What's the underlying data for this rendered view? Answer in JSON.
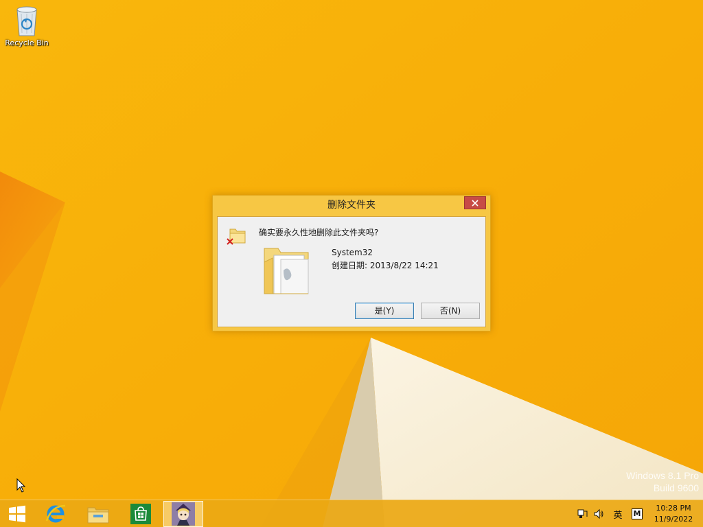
{
  "desktop": {
    "icons": [
      {
        "label": "Recycle Bin",
        "icon": "recycle-bin-icon"
      }
    ],
    "watermark": {
      "line1": "Windows 8.1 Pro",
      "line2": "Build 9600"
    }
  },
  "dialog": {
    "title": "删除文件夹",
    "question": "确实要永久性地删除此文件夹吗?",
    "item_name": "System32",
    "item_date": "创建日期: 2013/8/22 14:21",
    "yes_label": "是(Y)",
    "no_label": "否(N)",
    "icons": [
      "folder-delete-icon",
      "folder-icon",
      "close-icon"
    ]
  },
  "taskbar": {
    "pinned": [
      {
        "name": "start",
        "icon": "windows-logo-icon"
      },
      {
        "name": "internet-explorer",
        "icon": "internet-explorer-icon"
      },
      {
        "name": "file-explorer",
        "icon": "file-explorer-icon"
      },
      {
        "name": "store",
        "icon": "store-icon"
      },
      {
        "name": "active-app",
        "icon": "app-thumbnail-icon"
      }
    ],
    "tray": {
      "language": "英",
      "ime": "M",
      "time": "10:28 PM",
      "date": "11/9/2022"
    }
  },
  "colors": {
    "wallpaper": "#f8b20a",
    "dialog_frame": "#f7c744",
    "close_button": "#c74b46",
    "taskbar": "#eba814"
  }
}
